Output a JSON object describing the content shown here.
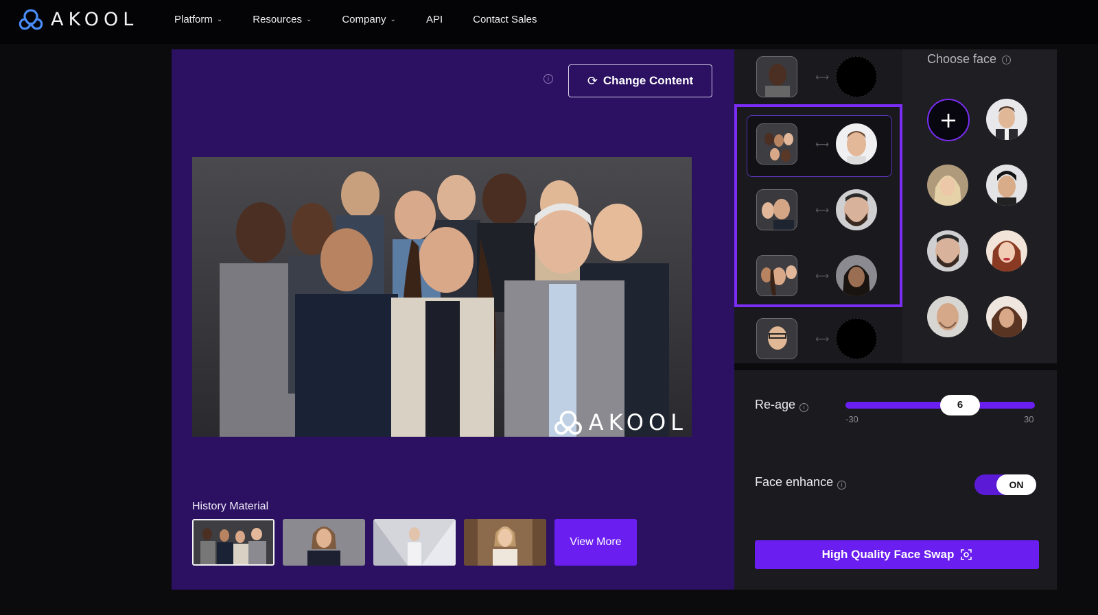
{
  "brand": {
    "logo_text": "AKOOL"
  },
  "nav": {
    "items": [
      {
        "label": "Platform",
        "dropdown": true
      },
      {
        "label": "Resources",
        "dropdown": true
      },
      {
        "label": "Company",
        "dropdown": true
      },
      {
        "label": "API",
        "dropdown": false
      },
      {
        "label": "Contact Sales",
        "dropdown": false
      }
    ]
  },
  "stage": {
    "change_content_label": "Change Content",
    "watermark_text": "AKOOL",
    "history_label": "History Material",
    "view_more_label": "View More"
  },
  "choose_face": {
    "title": "Choose face",
    "add_symbol": "+"
  },
  "settings": {
    "reage_label": "Re-age",
    "reage_value": "6",
    "reage_min": "-30",
    "reage_max": "30",
    "face_enhance_label": "Face enhance",
    "face_enhance_state": "ON",
    "hq_button_label": "High Quality Face Swap"
  },
  "colors": {
    "accent": "#6a1ff0",
    "stage_bg": "#2c1163",
    "page_bg": "#0b0b0d",
    "selection_border": "#7a2df5"
  }
}
